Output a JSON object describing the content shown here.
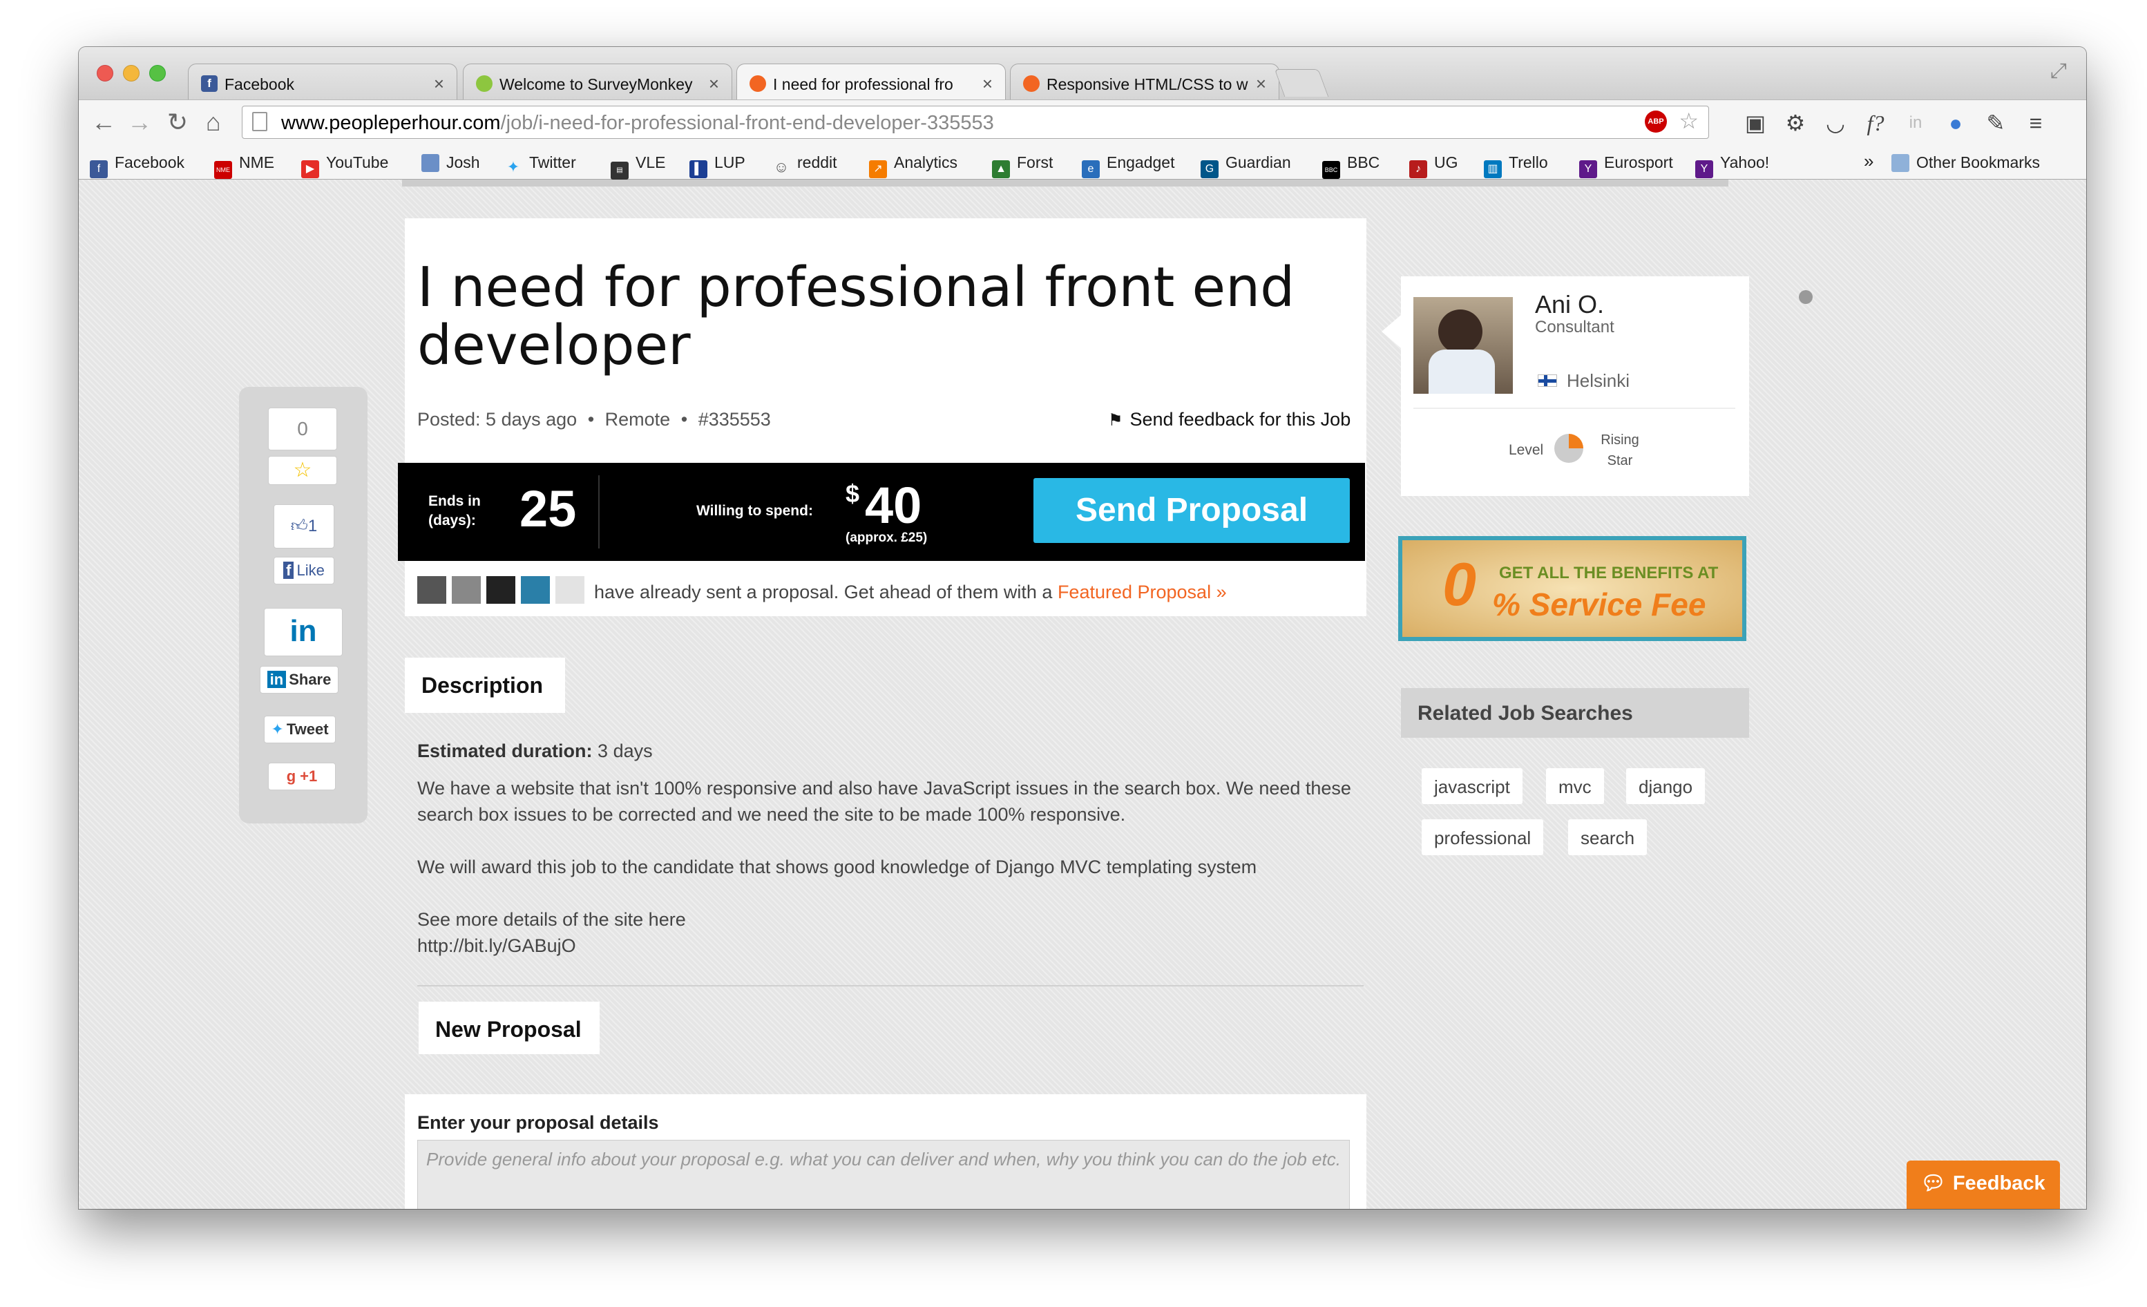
{
  "browser": {
    "tabs": [
      {
        "label": "Facebook",
        "favicon": "facebook-icon"
      },
      {
        "label": "Welcome to SurveyMonkey",
        "favicon": "surveymonkey-icon"
      },
      {
        "label": "I need for professional fro",
        "favicon": "peopleperhour-icon"
      },
      {
        "label": "Responsive HTML/CSS to w",
        "favicon": "peopleperhour-icon"
      }
    ],
    "url_host": "www.peopleperhour.com",
    "url_path": "/job/i-need-for-professional-front-end-developer-335553",
    "abp_label": "ABP",
    "bookmarks": [
      "Facebook",
      "NME",
      "YouTube",
      "Josh",
      "Twitter",
      "VLE",
      "LUP",
      "reddit",
      "Analytics",
      "Forst",
      "Engadget",
      "Guardian",
      "BBC",
      "UG",
      "Trello",
      "Eurosport",
      "Yahoo!"
    ],
    "bookmarks_overflow": "»",
    "other_bookmarks": "Other Bookmarks"
  },
  "job": {
    "title": "I need for professional front end developer",
    "posted": "Posted: 5 days ago",
    "location": "Remote",
    "id": "#335553",
    "feedback_link": "Send feedback for this Job",
    "ends_label": "Ends in (days):",
    "ends_value": "25",
    "spend_label": "Willing to spend:",
    "currency": "$",
    "amount": "40",
    "approx": "(approx. £25)",
    "send_button": "Send Proposal",
    "proposal_note": "have already sent a proposal. Get ahead of them with a",
    "featured_link": "Featured Proposal »"
  },
  "social": {
    "count": "0",
    "likes": "1",
    "fb_like": "Like",
    "li_share": "Share",
    "tweet": "Tweet",
    "gplus": "+1"
  },
  "description": {
    "tab": "Description",
    "duration_label": "Estimated duration:",
    "duration_value": "3 days",
    "p1a": "We have a website that isn't 100% responsive and also have JavaScript issues in the search box. We need these",
    "p1b": "search box issues to be corrected and we need the site to be made 100% responsive.",
    "p2": "We will award this job to the candidate that shows good knowledge of Django MVC templating system",
    "p3": "See more details of the site here",
    "link": "http://bit.ly/GABujO"
  },
  "proposal": {
    "tab": "New Proposal",
    "label": "Enter your proposal details",
    "placeholder": "Provide general info about your proposal e.g. what you can deliver and when, why you think you can do the job etc."
  },
  "buyer": {
    "name": "Ani O.",
    "role": "Consultant",
    "city": "Helsinki",
    "level_label": "Level",
    "level_value": "Rising Star"
  },
  "promo": {
    "zero": "0",
    "line1": "GET ALL THE BENEFITS AT",
    "line2": "% Service Fee"
  },
  "related": {
    "title": "Related Job Searches",
    "tags": [
      "javascript",
      "mvc",
      "django",
      "professional",
      "search"
    ]
  },
  "feedback_button": "Feedback"
}
